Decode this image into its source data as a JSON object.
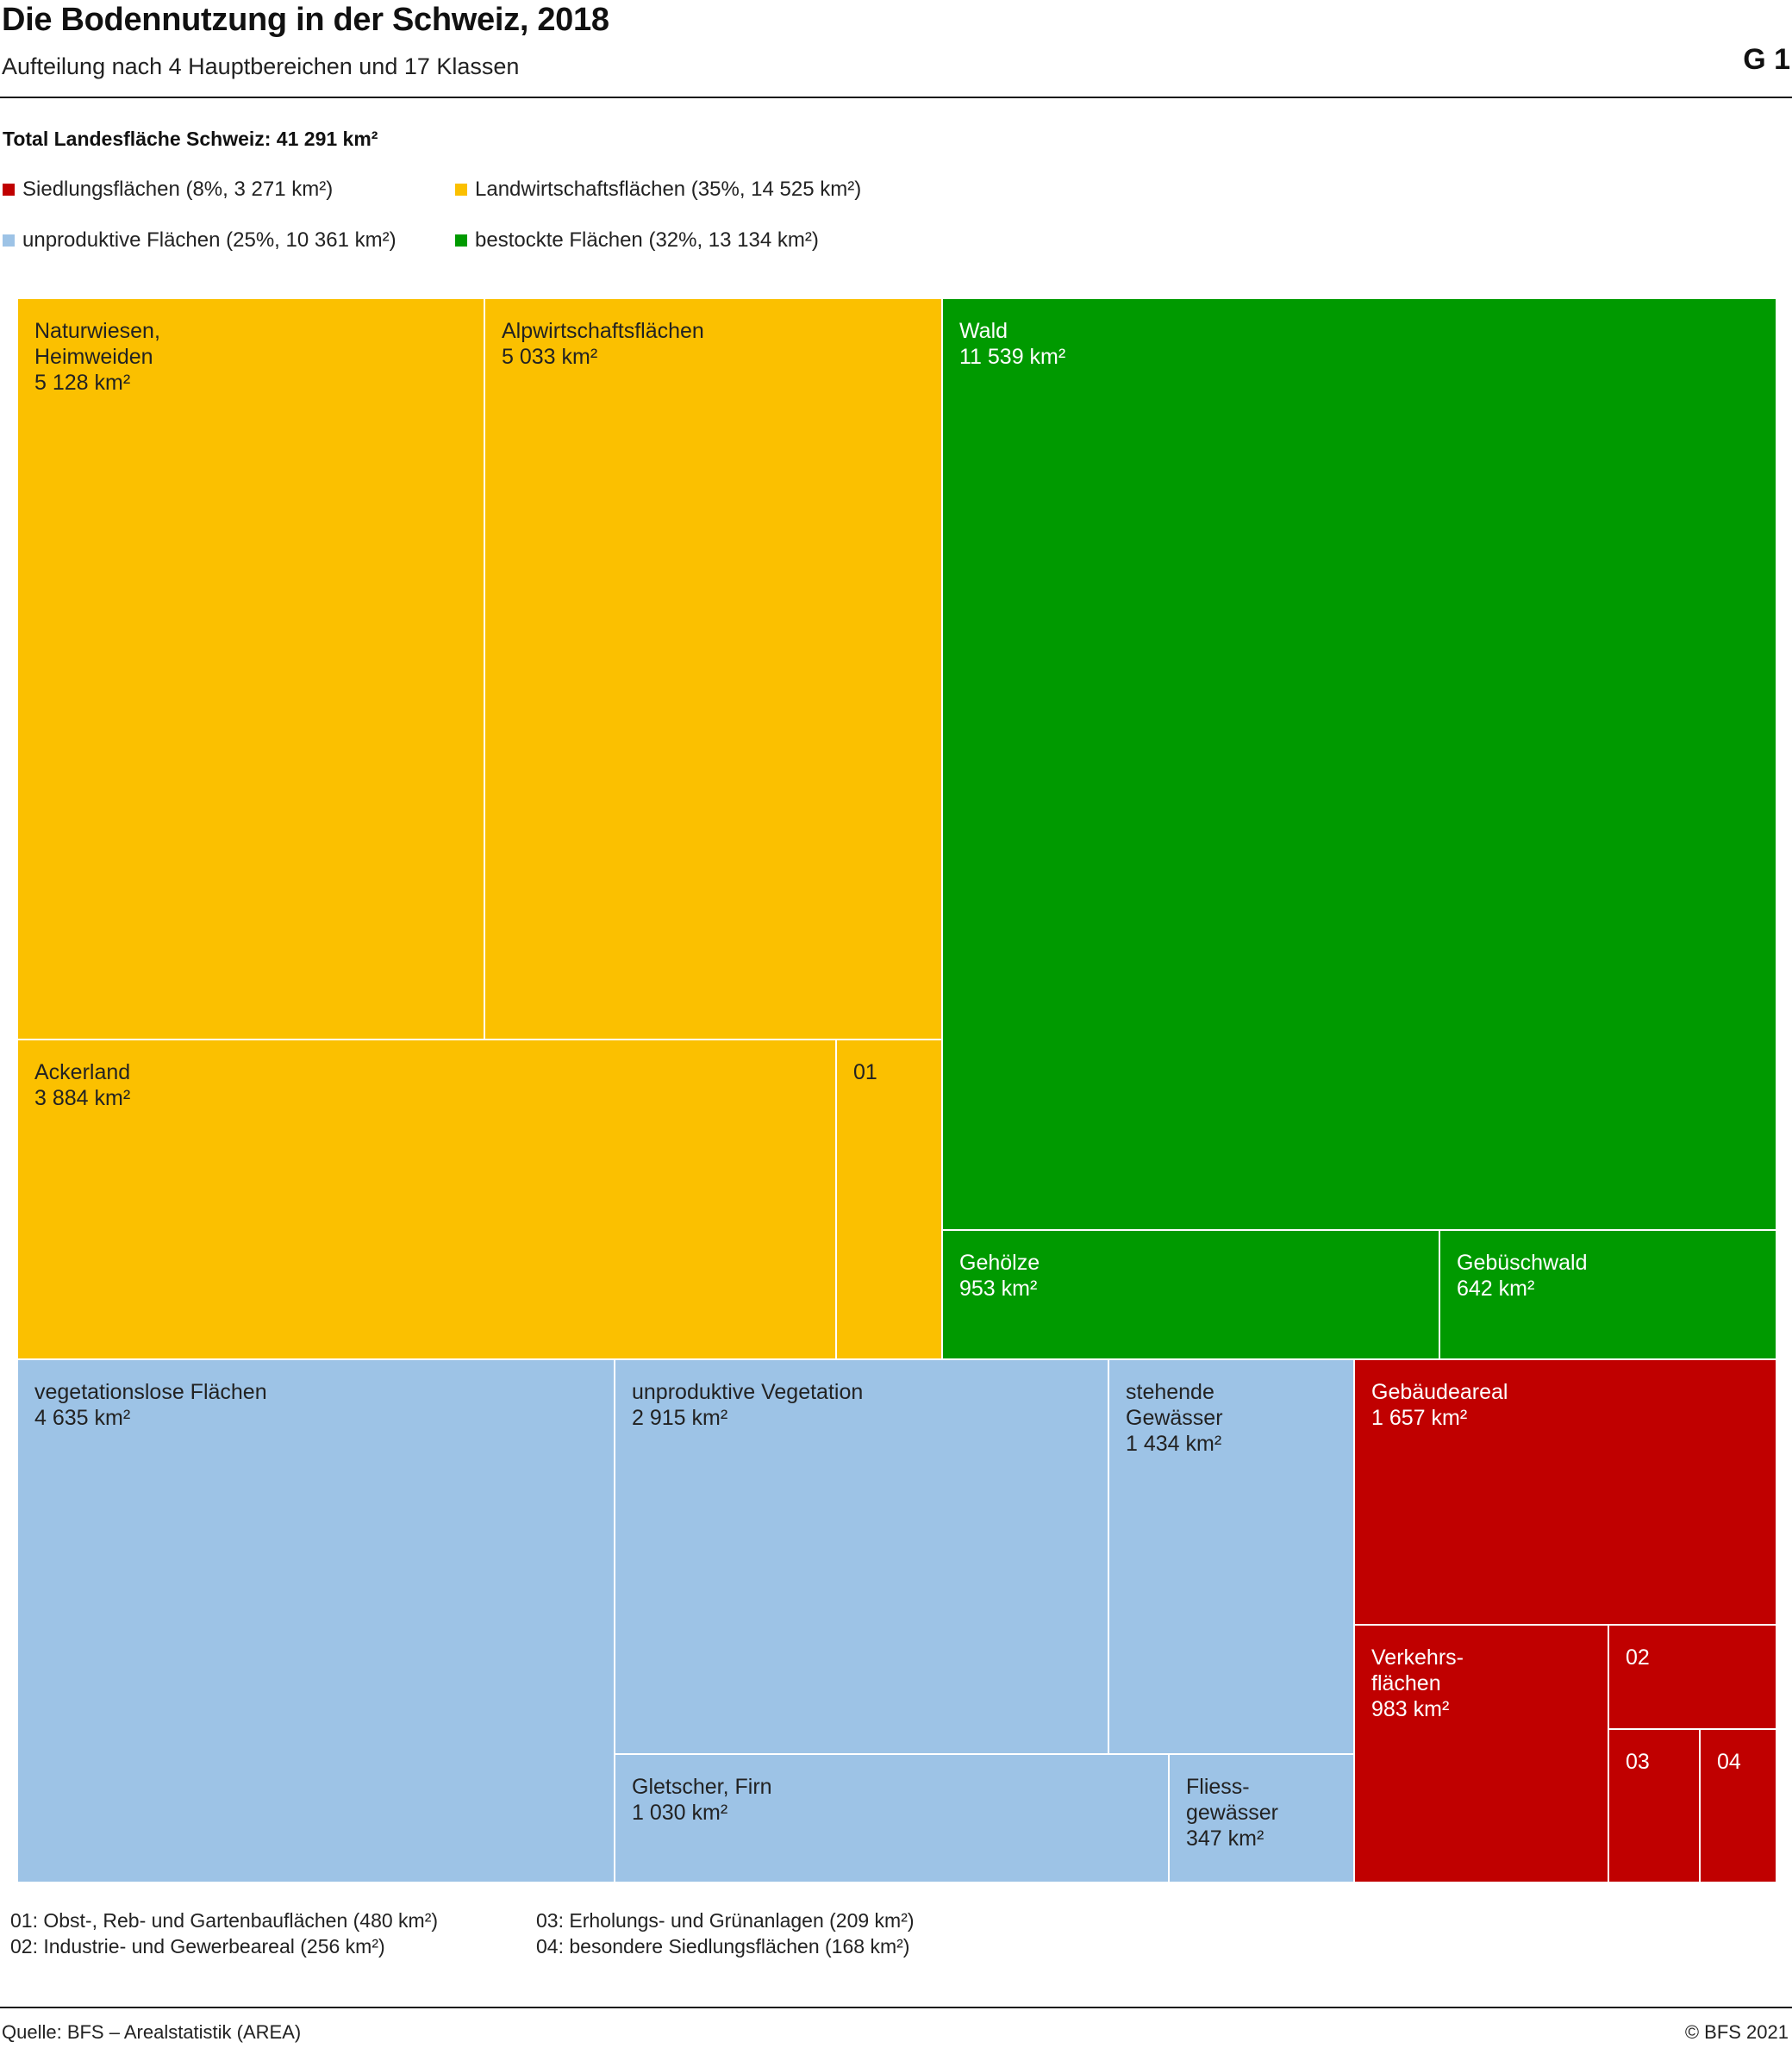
{
  "header": {
    "title": "Die Bodennutzung in der Schweiz, 2018",
    "subtitle": "Aufteilung nach 4 Hauptbereichen und 17 Klassen",
    "code": "G 1"
  },
  "colors": {
    "siedlung": "#c00000",
    "landwirtschaft": "#fbc000",
    "unproduktiv": "#9dc3e6",
    "bestockt": "#009a00"
  },
  "footer": {
    "source": "Quelle: BFS – Arealstatistik (AREA)",
    "copyright": "© BFS 2021"
  },
  "chart_data": {
    "type": "treemap",
    "total_label": "Total Landesfläche Schweiz: 41 291 km²",
    "total_km2": 41291,
    "groups": [
      {
        "key": "siedlung",
        "label": "Siedlungsflächen (8%, 3 271 km²)",
        "share_pct": 8,
        "area_km2": 3271
      },
      {
        "key": "landwirtschaft",
        "label": "Landwirtschaftsflächen (35%, 14 525 km²)",
        "share_pct": 35,
        "area_km2": 14525
      },
      {
        "key": "unproduktiv",
        "label": "unproduktive Flächen (25%, 10 361 km²)",
        "share_pct": 25,
        "area_km2": 10361
      },
      {
        "key": "bestockt",
        "label": "bestockte Flächen (32%, 13 134 km²)",
        "share_pct": 32,
        "area_km2": 13134
      }
    ],
    "classes": [
      {
        "id": "naturwiesen",
        "group": "landwirtschaft",
        "label": "Naturwiesen,\nHeimweiden\n5 128 km²",
        "area_km2": 5128
      },
      {
        "id": "alpwirtschaft",
        "group": "landwirtschaft",
        "label": "Alpwirtschaftsflächen\n5 033 km²",
        "area_km2": 5033
      },
      {
        "id": "ackerland",
        "group": "landwirtschaft",
        "label": "Ackerland\n3 884 km²",
        "area_km2": 3884
      },
      {
        "id": "obst",
        "group": "landwirtschaft",
        "label": "01",
        "area_km2": 480
      },
      {
        "id": "wald",
        "group": "bestockt",
        "label": "Wald\n11 539 km²",
        "area_km2": 11539
      },
      {
        "id": "gehoelze",
        "group": "bestockt",
        "label": "Gehölze\n953 km²",
        "area_km2": 953
      },
      {
        "id": "gebueschwald",
        "group": "bestockt",
        "label": "Gebüschwald\n642 km²",
        "area_km2": 642
      },
      {
        "id": "vegetationslos",
        "group": "unproduktiv",
        "label": "vegetationslose Flächen\n4 635 km²",
        "area_km2": 4635
      },
      {
        "id": "unprod-vegetation",
        "group": "unproduktiv",
        "label": "unproduktive Vegetation\n2 915 km²",
        "area_km2": 2915
      },
      {
        "id": "stehende-gewaesser",
        "group": "unproduktiv",
        "label": "stehende\nGewässer\n1 434 km²",
        "area_km2": 1434
      },
      {
        "id": "gletscher",
        "group": "unproduktiv",
        "label": "Gletscher, Firn\n1 030 km²",
        "area_km2": 1030
      },
      {
        "id": "fliessgewaesser",
        "group": "unproduktiv",
        "label": "Fliess-\ngewässer\n347 km²",
        "area_km2": 347
      },
      {
        "id": "gebaeudeareal",
        "group": "siedlung",
        "label": "Gebäudeareal\n1 657 km²",
        "area_km2": 1657
      },
      {
        "id": "verkehr",
        "group": "siedlung",
        "label": "Verkehrs-\nflächen\n983 km²",
        "area_km2": 983
      },
      {
        "id": "industrie",
        "group": "siedlung",
        "label": "02",
        "area_km2": 256
      },
      {
        "id": "erholung",
        "group": "siedlung",
        "label": "03",
        "area_km2": 209
      },
      {
        "id": "besondere",
        "group": "siedlung",
        "label": "04",
        "area_km2": 168
      }
    ],
    "notes": [
      "01: Obst-, Reb- und Gartenbauflächen (480 km²)",
      "02: Industrie- und Gewerbeareal (256 km²)",
      "03: Erholungs- und Grünanlagen (209 km²)",
      "04: besondere Siedlungsflächen (168 km²)"
    ]
  }
}
